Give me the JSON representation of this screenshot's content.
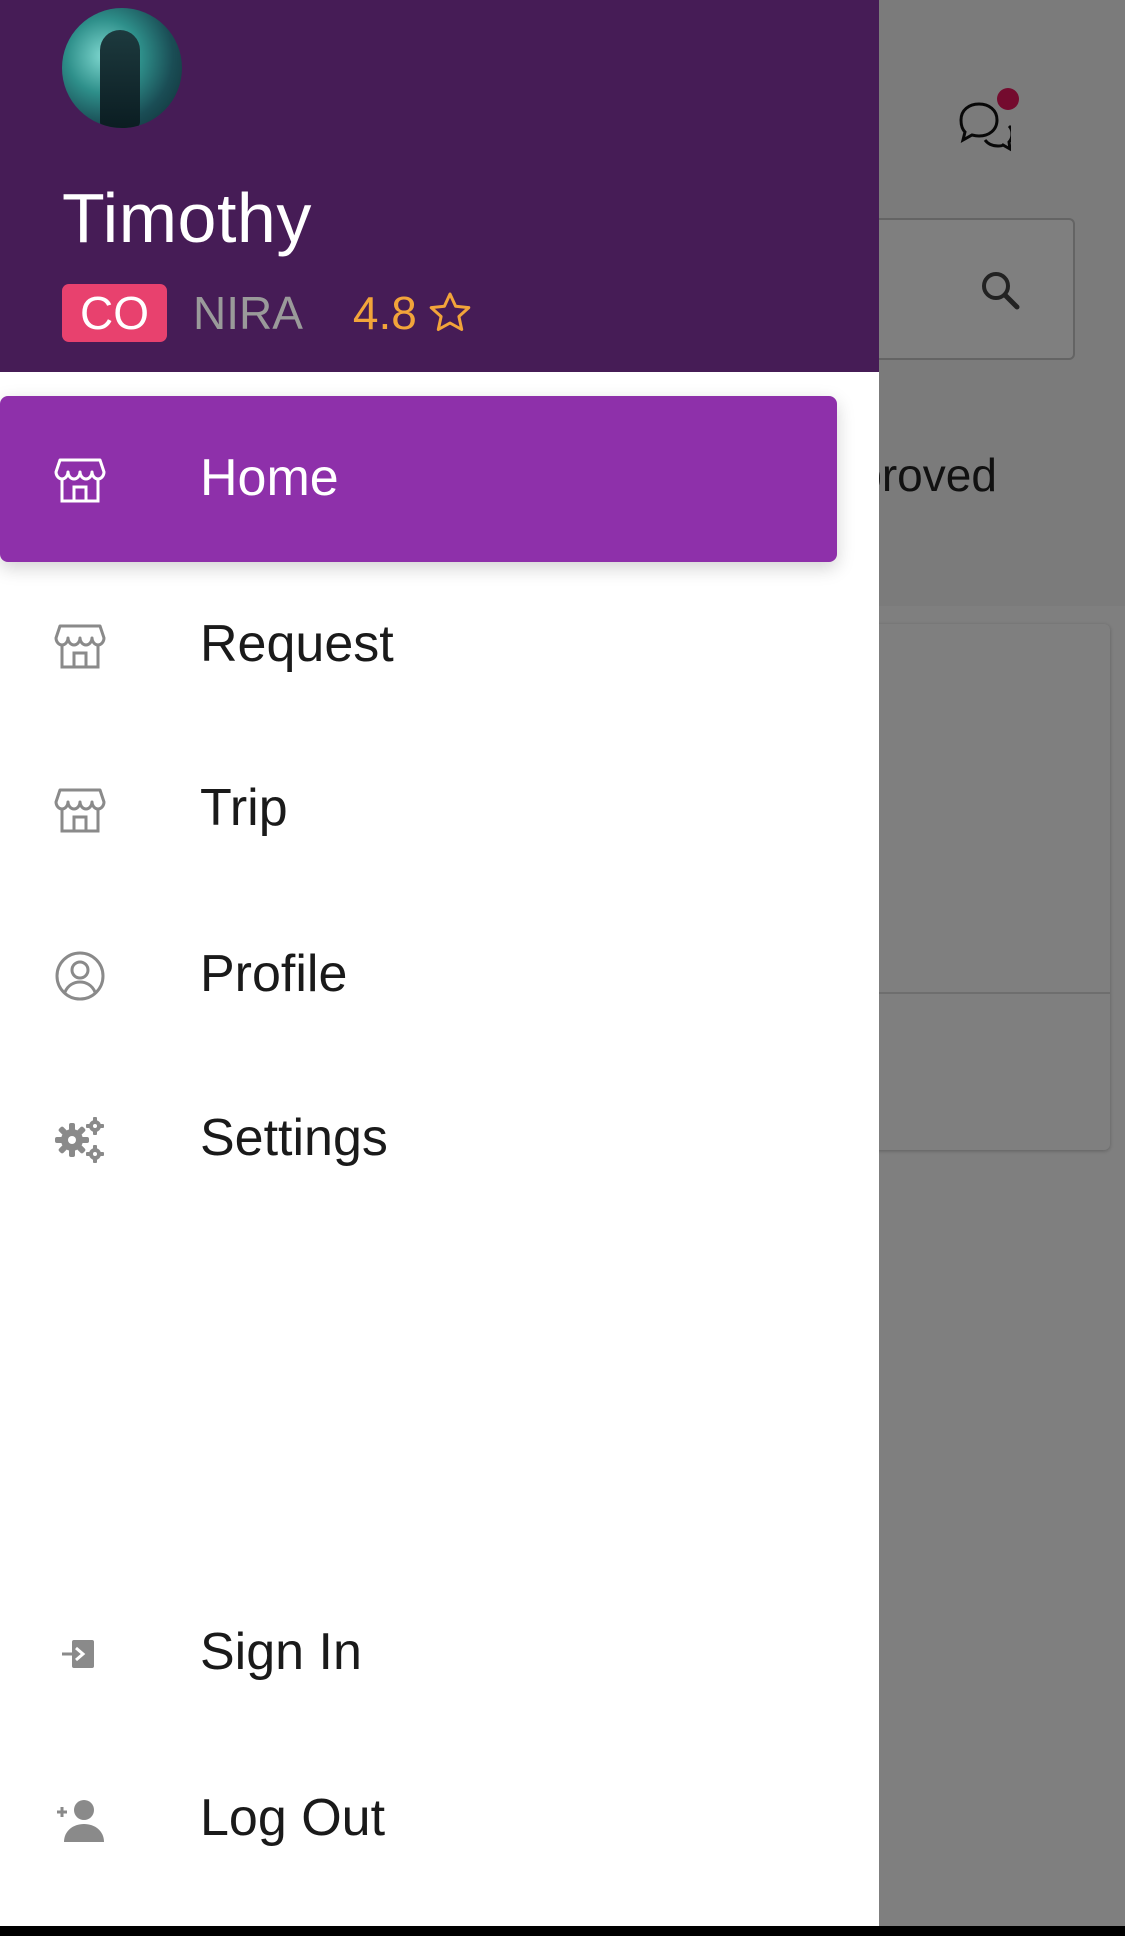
{
  "background": {
    "tab_label": "Approved",
    "chat_icon": "chat-bubbles-icon",
    "search_icon": "search-icon",
    "accent_dot": "#e8175d"
  },
  "drawer": {
    "user": {
      "name": "Timothy",
      "badge": "CO",
      "org": "NIRA",
      "rating": "4.8",
      "avatar": "avatar"
    },
    "colors": {
      "header_bg": "#461c56",
      "active_bg": "#8e30aa",
      "badge_bg": "#e8416e",
      "rating": "#f2a43a"
    },
    "items": [
      {
        "label": "Home",
        "icon": "store-icon",
        "active": true
      },
      {
        "label": "Request",
        "icon": "store-icon",
        "active": false
      },
      {
        "label": "Trip",
        "icon": "store-icon",
        "active": false
      },
      {
        "label": "Profile",
        "icon": "user-circle-icon",
        "active": false
      },
      {
        "label": "Settings",
        "icon": "gears-icon",
        "active": false
      }
    ],
    "bottom_items": [
      {
        "label": "Sign In",
        "icon": "sign-in-icon"
      },
      {
        "label": "Log Out",
        "icon": "user-plus-icon"
      }
    ]
  }
}
